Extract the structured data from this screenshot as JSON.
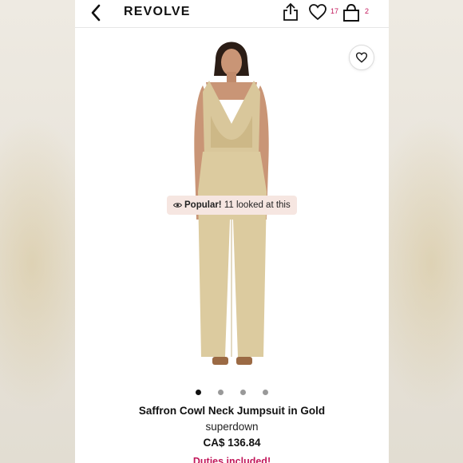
{
  "header": {
    "logo": "REVOLVE",
    "wishlist_count": "17",
    "bag_count": "2"
  },
  "product": {
    "popular_label": "Popular!",
    "popular_text": " 11 looked at this",
    "image_count": 4,
    "active_image": 1,
    "name": "Saffron Cowl Neck Jumpsuit in Gold",
    "brand": "superdown",
    "price": "CA$ 136.84",
    "duties_note": "Duties included!"
  },
  "colors": {
    "accent": "#c2185b",
    "badge_bg": "#f6e6e1",
    "garment_gold": "#d9c79b"
  },
  "icons": [
    "back-arrow-icon",
    "share-icon",
    "heart-icon",
    "shopping-bag-icon",
    "eye-icon"
  ]
}
